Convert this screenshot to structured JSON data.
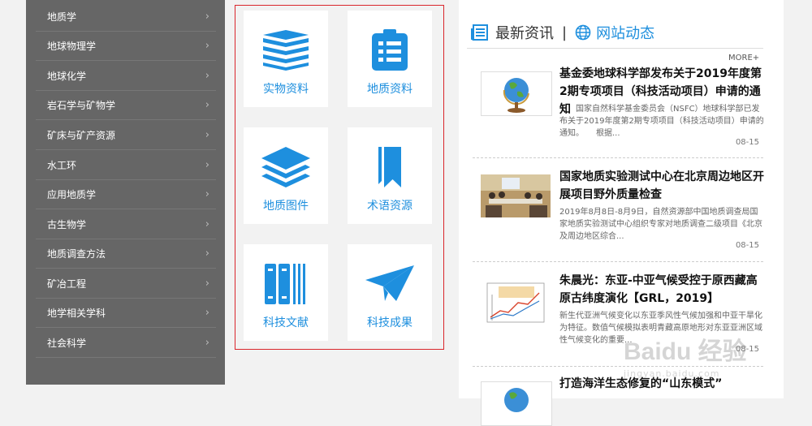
{
  "sidebar": {
    "items": [
      {
        "label": "地质学"
      },
      {
        "label": "地球物理学"
      },
      {
        "label": "地球化学"
      },
      {
        "label": "岩石学与矿物学"
      },
      {
        "label": "矿床与矿产资源"
      },
      {
        "label": "水工环"
      },
      {
        "label": "应用地质学"
      },
      {
        "label": "古生物学"
      },
      {
        "label": "地质调查方法"
      },
      {
        "label": "矿冶工程"
      },
      {
        "label": "地学相关学科"
      },
      {
        "label": "社会科学"
      }
    ],
    "chevron": "›"
  },
  "resources": {
    "tiles": [
      {
        "label": "实物资料",
        "icon": "books-stack-icon"
      },
      {
        "label": "地质资料",
        "icon": "clipboard-icon"
      },
      {
        "label": "地质图件",
        "icon": "layers-icon"
      },
      {
        "label": "术语资源",
        "icon": "bookmark-icon"
      },
      {
        "label": "科技文献",
        "icon": "book-spines-icon"
      },
      {
        "label": "科技成果",
        "icon": "paper-plane-icon"
      }
    ],
    "accent": "#1e8fde"
  },
  "news": {
    "tab_active": "最新资讯",
    "separator": "|",
    "tab_other": "网站动态",
    "more": "MORE+",
    "articles": [
      {
        "title": "基金委地球科学部发布关于2019年度第2期专项项目（科技活动项目）申请的通知",
        "summary": "国家自然科学基金委员会（NSFC）地球科学部已发布关于2019年度第2期专项项目（科技活动项目）申请的通知。　　根据...",
        "date": "08-15"
      },
      {
        "title": "国家地质实验测试中心在北京周边地区开展项目野外质量检查",
        "summary": "2019年8月8日-8月9日，自然资源部中国地质调查局国家地质实验测试中心组织专家对地质调查二级项目《北京及周边地区综合...",
        "date": "08-15"
      },
      {
        "title": "朱晨光：东亚-中亚气候受控于原西藏高原古纬度演化【GRL，2019】",
        "summary": "新生代亚洲气候变化以东亚季风性气候加强和中亚干旱化为特征。数值气候模拟表明青藏高原地形对东亚亚洲区域性气候变化的重要...",
        "date": "08-15"
      },
      {
        "title": "打造海洋生态修复的“山东模式”",
        "summary": "",
        "date": ""
      }
    ]
  },
  "watermark": {
    "text": "Baidu 经验",
    "sub": "jingyan.baidu.com"
  }
}
